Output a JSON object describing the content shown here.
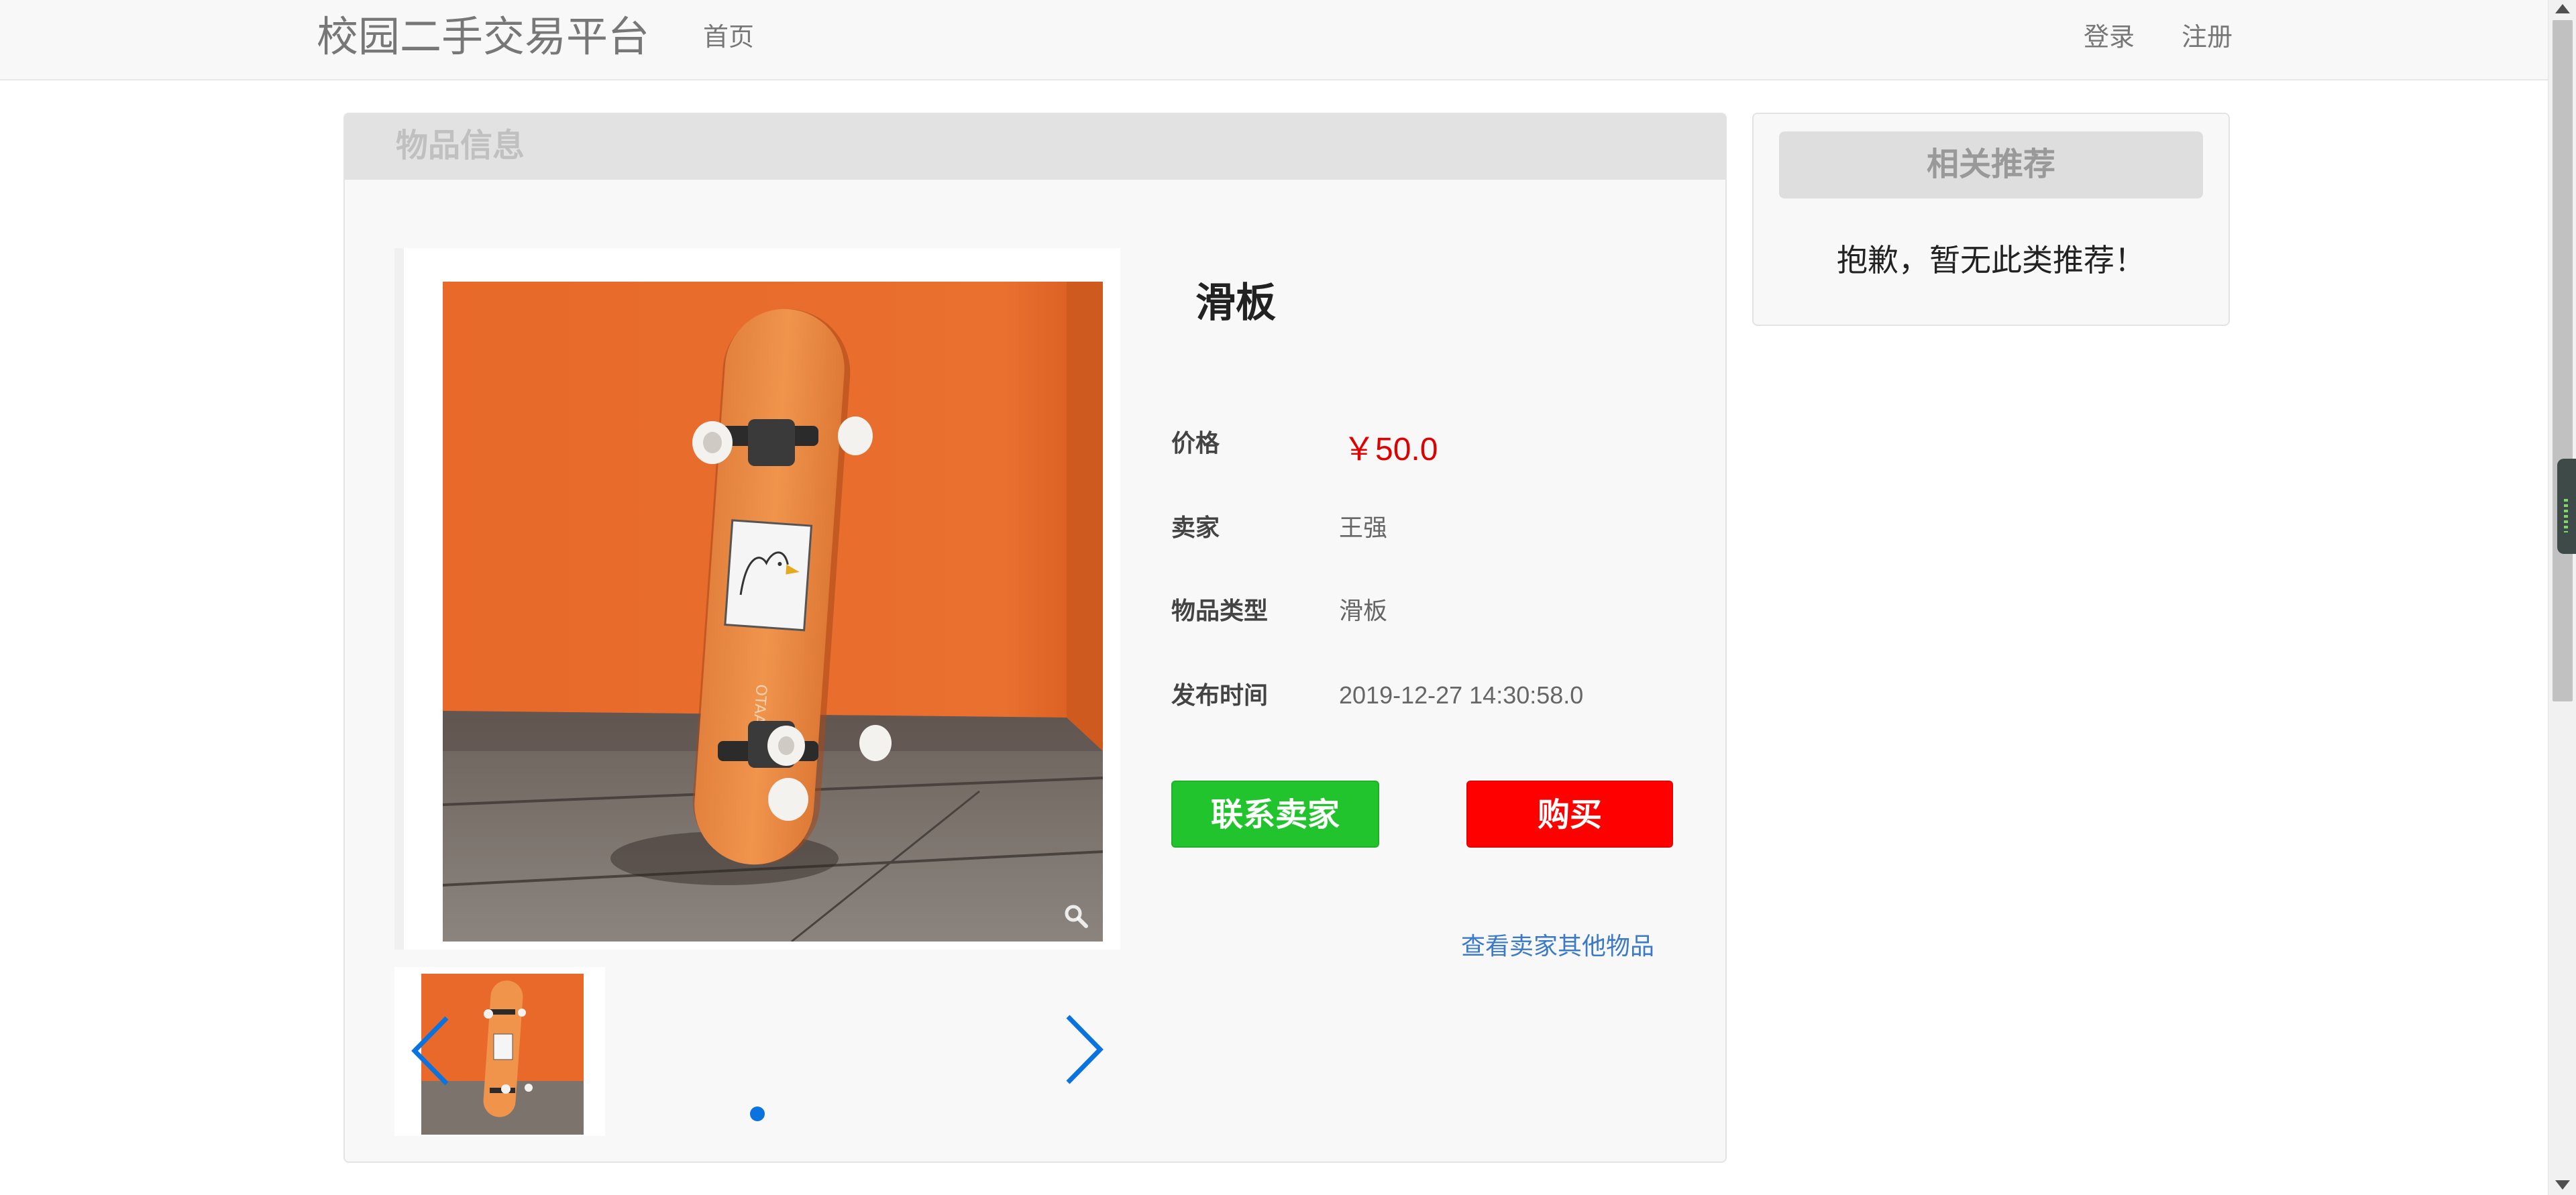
{
  "navbar": {
    "brand": "校园二手交易平台",
    "home": "首页",
    "login": "登录",
    "register": "注册"
  },
  "panel": {
    "title": "物品信息"
  },
  "item": {
    "name": "滑板",
    "price_label": "价格",
    "price": "￥50.0",
    "seller_label": "卖家",
    "seller": "王强",
    "type_label": "物品类型",
    "type": "滑板",
    "time_label": "发布时间",
    "time": "2019-12-27 14:30:58.0",
    "image_board_text": "OTAAKANO"
  },
  "actions": {
    "contact": "联系卖家",
    "buy": "购买",
    "seller_other": "查看卖家其他物品"
  },
  "recommend": {
    "title": "相关推荐",
    "empty": "抱歉，暂无此类推荐！"
  },
  "colors": {
    "price": "#e00000",
    "contact_button": "#21c42d",
    "buy_button": "#ff0000",
    "link": "#3a7ac8",
    "carousel_accent": "#0b73e0"
  },
  "icons": {
    "zoom": "magnifier-icon",
    "prev": "chevron-left-icon",
    "next": "chevron-right-icon"
  }
}
